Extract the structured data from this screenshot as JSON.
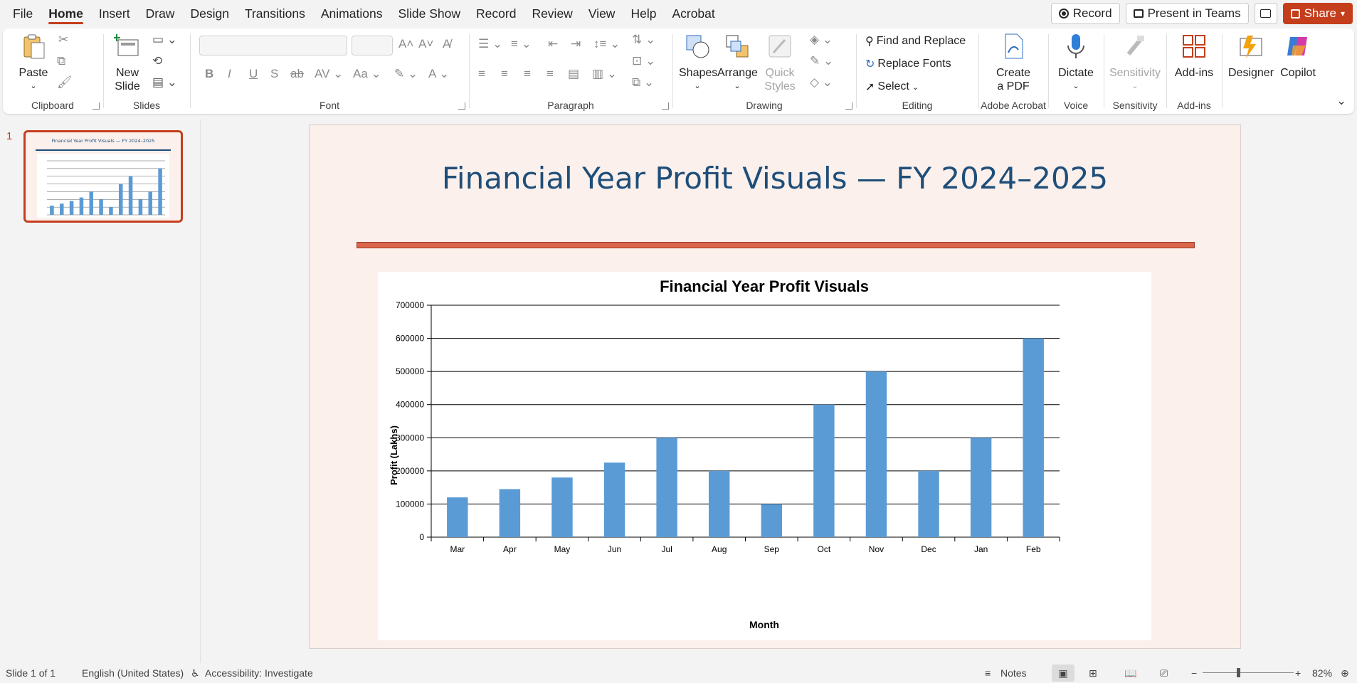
{
  "menu": {
    "tabs": [
      "File",
      "Home",
      "Insert",
      "Draw",
      "Design",
      "Transitions",
      "Animations",
      "Slide Show",
      "Record",
      "Review",
      "View",
      "Help",
      "Acrobat"
    ],
    "active_tab": "Home",
    "record_btn": "Record",
    "present_btn": "Present in Teams",
    "share_btn": "Share"
  },
  "ribbon": {
    "clipboard": {
      "label": "Clipboard",
      "paste": "Paste"
    },
    "slides": {
      "label": "Slides",
      "new_slide_1": "New",
      "new_slide_2": "Slide"
    },
    "font": {
      "label": "Font"
    },
    "paragraph": {
      "label": "Paragraph"
    },
    "drawing": {
      "label": "Drawing",
      "shapes": "Shapes",
      "arrange": "Arrange",
      "quick_1": "Quick",
      "quick_2": "Styles"
    },
    "editing": {
      "label": "Editing",
      "find": "Find and Replace",
      "replace_fonts": "Replace Fonts",
      "select": "Select"
    },
    "acrobat": {
      "label": "Adobe Acrobat",
      "create_1": "Create",
      "create_2": "a PDF"
    },
    "voice": {
      "label": "Voice",
      "dictate": "Dictate"
    },
    "sensitivity": {
      "label": "Sensitivity",
      "btn": "Sensitivity"
    },
    "addins": {
      "label": "Add-ins",
      "btn": "Add-ins"
    },
    "designer": "Designer",
    "copilot": "Copilot"
  },
  "thumbnails": {
    "slide_number": "1"
  },
  "slide": {
    "title": "Financial Year Profit Visuals — FY 2024–2025",
    "accent_color": "#d9654a",
    "title_color": "#1f4e79"
  },
  "chart_data": {
    "type": "bar",
    "title": "Financial Year Profit Visuals",
    "xlabel": "Month",
    "ylabel": "Profit (Lakhs)",
    "categories": [
      "Mar",
      "Apr",
      "May",
      "Jun",
      "Jul",
      "Aug",
      "Sep",
      "Oct",
      "Nov",
      "Dec",
      "Jan",
      "Feb"
    ],
    "values": [
      120000,
      145000,
      180000,
      225000,
      300000,
      200000,
      100000,
      400000,
      500000,
      200000,
      300000,
      600000
    ],
    "ylim": [
      0,
      700000
    ],
    "yticks": [
      0,
      100000,
      200000,
      300000,
      400000,
      500000,
      600000,
      700000
    ],
    "grid": true,
    "bar_color": "#5b9bd5"
  },
  "status": {
    "slide_info": "Slide 1 of 1",
    "language": "English (United States)",
    "accessibility": "Accessibility: Investigate",
    "notes": "Notes",
    "zoom": "82%"
  }
}
